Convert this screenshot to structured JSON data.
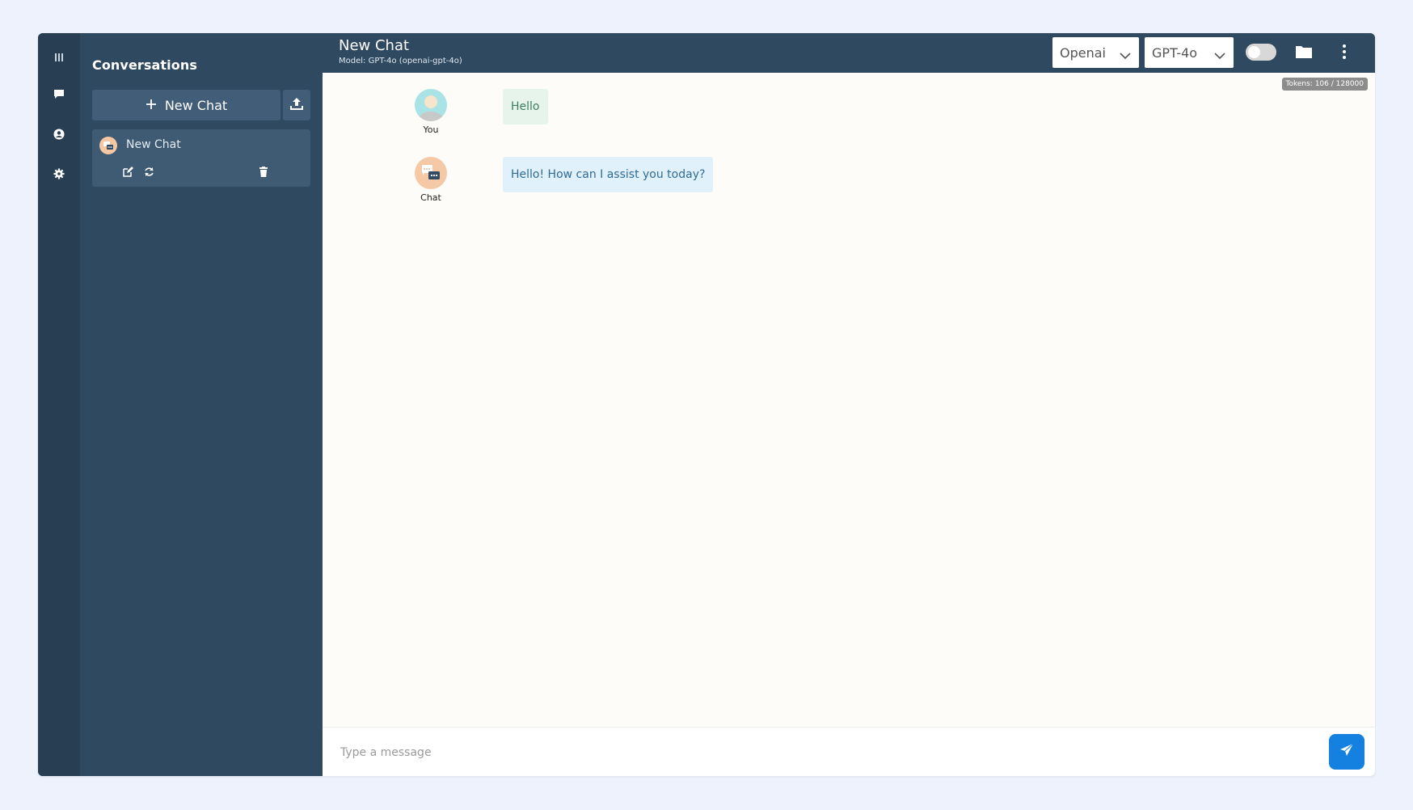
{
  "sidebar": {
    "title": "Conversations",
    "new_chat_label": "New Chat",
    "conversations": [
      {
        "title": "New Chat"
      }
    ]
  },
  "iconbar": {
    "items": [
      "menu-icon",
      "chat-icon",
      "user-icon",
      "settings-icon"
    ]
  },
  "header": {
    "title": "New Chat",
    "model_line": "Model: GPT-4o (openai-gpt-4o)",
    "provider_select": "Openai",
    "model_select": "GPT-4o"
  },
  "tokens": "Tokens: 106 / 128000",
  "messages": [
    {
      "sender": "You",
      "text": "Hello"
    },
    {
      "sender": "Chat",
      "text": "Hello! How can I assist you today?"
    }
  ],
  "composer": {
    "placeholder": "Type a message"
  },
  "colors": {
    "sidebar_bg": "#2f4a60",
    "iconbar_bg": "#283f53",
    "user_bubble": "#e6f4ec",
    "bot_bubble": "#e1f1fb",
    "send_button": "#1480e0"
  }
}
